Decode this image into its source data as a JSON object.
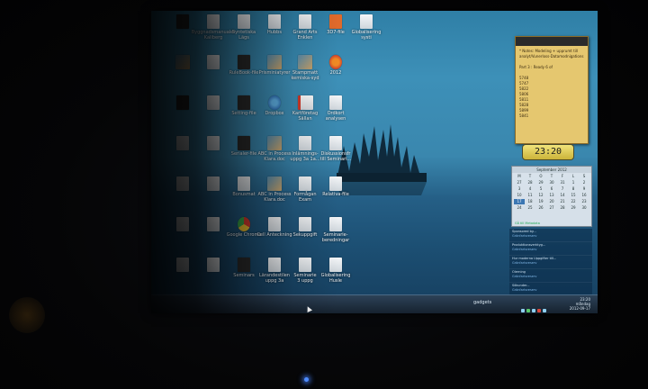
{
  "desktop": {
    "icons": [
      {
        "label": "",
        "kind": "dark",
        "col": 0,
        "row": 0
      },
      {
        "label": "Byggnadsmanualer\nKaliberg",
        "kind": "doc",
        "col": 1,
        "row": 0
      },
      {
        "label": "Syntetiska\nLägs",
        "kind": "doc",
        "col": 2,
        "row": 0
      },
      {
        "label": "Hubbs",
        "kind": "doc",
        "col": 3,
        "row": 0
      },
      {
        "label": "Grand Arts\nEnklen",
        "kind": "doc",
        "col": 4,
        "row": 0
      },
      {
        "label": "3D7-file",
        "kind": "ppt",
        "col": 5,
        "row": 0
      },
      {
        "label": "Globalisering\nsysti",
        "kind": "doc",
        "col": 6,
        "row": 0
      },
      {
        "label": "",
        "kind": "pic",
        "col": 0,
        "row": 1
      },
      {
        "label": "",
        "kind": "doc",
        "col": 1,
        "row": 1
      },
      {
        "label": "RuleBook-file",
        "kind": "dark",
        "col": 2,
        "row": 1
      },
      {
        "label": "Prisminiatyrer",
        "kind": "pic",
        "col": 3,
        "row": 1
      },
      {
        "label": "Stampmatt\nkemiska-syd",
        "kind": "pic",
        "col": 4,
        "row": 1
      },
      {
        "label": "2012",
        "kind": "ff",
        "col": 5,
        "row": 1
      },
      {
        "label": "",
        "kind": "dark",
        "col": 0,
        "row": 2
      },
      {
        "label": "",
        "kind": "doc",
        "col": 1,
        "row": 2
      },
      {
        "label": "Setting-file",
        "kind": "dark",
        "col": 2,
        "row": 2
      },
      {
        "label": "Dropbox",
        "kind": "blue",
        "col": 3,
        "row": 2
      },
      {
        "label": "Kartföretag\nSällan",
        "kind": "pdf",
        "col": 4,
        "row": 2
      },
      {
        "label": "Ordkort\nanalysen",
        "kind": "doc",
        "col": 5,
        "row": 2
      },
      {
        "label": "",
        "kind": "doc",
        "col": 0,
        "row": 3
      },
      {
        "label": "",
        "kind": "doc",
        "col": 1,
        "row": 3
      },
      {
        "label": "Serialer-file",
        "kind": "dark",
        "col": 2,
        "row": 3
      },
      {
        "label": "ABC in Process\nKlara.doc",
        "kind": "pic",
        "col": 3,
        "row": 3
      },
      {
        "label": "Inlämnings-\nuppg 3a 1a...",
        "kind": "doc",
        "col": 4,
        "row": 3
      },
      {
        "label": "Diskussionsfr\ntill Seminari...",
        "kind": "doc",
        "col": 5,
        "row": 3
      },
      {
        "label": "",
        "kind": "doc",
        "col": 0,
        "row": 4
      },
      {
        "label": "",
        "kind": "doc",
        "col": 1,
        "row": 4
      },
      {
        "label": "Bonusmat",
        "kind": "doc",
        "col": 2,
        "row": 4
      },
      {
        "label": "ABC in Process\nKlara.doc",
        "kind": "pic",
        "col": 3,
        "row": 4
      },
      {
        "label": "Formågan\nExam",
        "kind": "doc",
        "col": 4,
        "row": 4
      },
      {
        "label": "Relativa-file",
        "kind": "doc",
        "col": 5,
        "row": 4
      },
      {
        "label": "",
        "kind": "doc",
        "col": 0,
        "row": 5
      },
      {
        "label": "",
        "kind": "doc",
        "col": 1,
        "row": 5
      },
      {
        "label": "Google Chrome",
        "kind": "chr",
        "col": 2,
        "row": 5
      },
      {
        "label": "Cell Anteckning",
        "kind": "doc",
        "col": 3,
        "row": 5
      },
      {
        "label": "Sekuppgift",
        "kind": "doc",
        "col": 4,
        "row": 5
      },
      {
        "label": "Seminarie-\nberedningar",
        "kind": "doc",
        "col": 5,
        "row": 5
      },
      {
        "label": "",
        "kind": "doc",
        "col": 0,
        "row": 6
      },
      {
        "label": "",
        "kind": "doc",
        "col": 1,
        "row": 6
      },
      {
        "label": "Seminars",
        "kind": "dark",
        "col": 2,
        "row": 6
      },
      {
        "label": "Lärandestilen\nuppg 3a",
        "kind": "doc",
        "col": 3,
        "row": 6
      },
      {
        "label": "Seminarie\n3 uppg",
        "kind": "doc",
        "col": 4,
        "row": 6
      },
      {
        "label": "Globalisering\nHusle",
        "kind": "doc",
        "col": 5,
        "row": 6
      }
    ]
  },
  "sidebar": {
    "notes_text": "* Notes: Modeling + upprumt till\nanalyt/Vunerloss-Datamodnigations\n\nPart 3 : Ready 6 of\n\n5748\n5747\n5822\n5806\n5811\n5828\n5899\n5841",
    "clock": "23:20",
    "calendar": {
      "header": "September 2012",
      "weekdays": [
        "M",
        "T",
        "O",
        "T",
        "F",
        "L",
        "S"
      ],
      "days": [
        "27",
        "28",
        "29",
        "30",
        "31",
        "1",
        "2",
        "3",
        "4",
        "5",
        "6",
        "7",
        "8",
        "9",
        "10",
        "11",
        "12",
        "13",
        "14",
        "15",
        "16",
        "17",
        "18",
        "19",
        "20",
        "21",
        "22",
        "23",
        "24",
        "25",
        "26",
        "27",
        "28",
        "29",
        "30"
      ],
      "selected": "17",
      "footer": "Gå till Metadata"
    },
    "feed": [
      {
        "title": "Sponsored by...",
        "meta": "Grönfartsreserv"
      },
      {
        "title": "Produktionsverktyg...",
        "meta": "Grönfartsreserv"
      },
      {
        "title": "Hur moderna Uppgifter till...",
        "meta": "Grönfartsreserv"
      },
      {
        "title": "Olerning",
        "meta": "Grönfartsreserv"
      },
      {
        "title": "Sökunder...",
        "meta": "Grönfartsreserv"
      },
      {
        "title": "Nytt svar...",
        "meta": "Grönfartsreserv"
      }
    ]
  },
  "taskbar": {
    "gadgets_label": "gadgets",
    "time": "23:20\nmåndag\n2012-09-17"
  }
}
